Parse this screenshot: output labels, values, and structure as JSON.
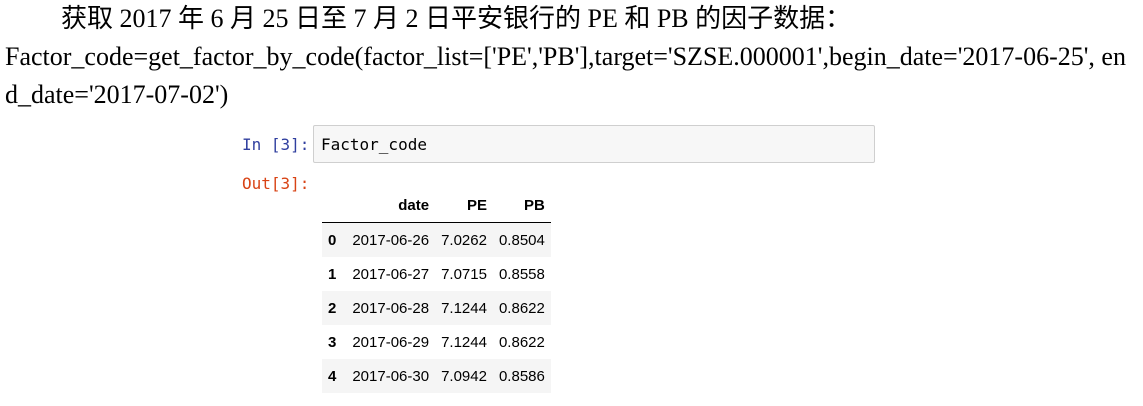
{
  "prose": {
    "line1": "获取 2017 年 6 月 25 日至 7 月 2 日平安银行的 PE 和 PB 的因子数据：",
    "code": "Factor_code=get_factor_by_code(factor_list=['PE','PB'],target='SZSE.000001',begin_date='2017-06-25', end_date='2017-07-02')"
  },
  "cell": {
    "in_prompt": "In [3]:",
    "input": "Factor_code",
    "out_prompt": "Out[3]:"
  },
  "table": {
    "columns": [
      "",
      "date",
      "PE",
      "PB"
    ],
    "rows": [
      {
        "index": "0",
        "date": "2017-06-26",
        "pe": "7.0262",
        "pb": "0.8504"
      },
      {
        "index": "1",
        "date": "2017-06-27",
        "pe": "7.0715",
        "pb": "0.8558"
      },
      {
        "index": "2",
        "date": "2017-06-28",
        "pe": "7.1244",
        "pb": "0.8622"
      },
      {
        "index": "3",
        "date": "2017-06-29",
        "pe": "7.1244",
        "pb": "0.8622"
      },
      {
        "index": "4",
        "date": "2017-06-30",
        "pe": "7.0942",
        "pb": "0.8586"
      }
    ]
  }
}
